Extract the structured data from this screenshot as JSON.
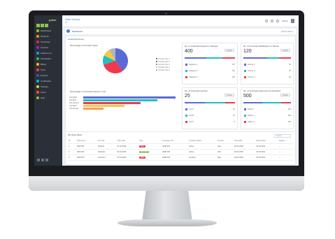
{
  "app": {
    "logo_text": "pulse",
    "school_name": "Sabi School",
    "school_sub": "ID",
    "user_name": "Admin",
    "accent": "#3f7fe0"
  },
  "sidebar": {
    "items": [
      {
        "label": "Dashboard",
        "color": "#8bc34a"
      },
      {
        "label": "Students",
        "color": "#ff9800"
      },
      {
        "label": "Instructors",
        "color": "#e91e63"
      },
      {
        "label": "Courses",
        "color": "#9c27b0"
      },
      {
        "label": "Classrooms",
        "color": "#03a9f4"
      },
      {
        "label": "Scheduling",
        "color": "#4caf50"
      },
      {
        "label": "Billing",
        "color": "#ffc107"
      },
      {
        "label": "Tests",
        "color": "#f44336"
      },
      {
        "label": "Reports",
        "color": "#3f51b5"
      },
      {
        "label": "Certificates",
        "color": "#00bcd4"
      },
      {
        "label": "Settings",
        "color": "#cddc39"
      },
      {
        "label": "Users",
        "color": "#ff5722"
      },
      {
        "label": "Help",
        "color": "#8bc34a"
      }
    ]
  },
  "page_header": {
    "title": "Dashboard",
    "right_label": "Admin Menu"
  },
  "summary": {
    "title": "Overall Summary"
  },
  "pie_card": {
    "title": "Percentage of Contract Types",
    "legend": [
      "Contract Type 1",
      "Contract Type 2",
      "Contract Type 3",
      "Contract Type 4",
      "Contract Type 5"
    ]
  },
  "pie_data": [
    {
      "value": 40,
      "color": "#5b6bd6"
    },
    {
      "value": 30,
      "color": "#f0384f"
    },
    {
      "value": 12,
      "color": "#1ec1c0"
    },
    {
      "value": 10,
      "color": "#f7c842"
    },
    {
      "value": 8,
      "color": "#b0b5bd"
    }
  ],
  "bar_card": {
    "title": "Percentage of contracts based on Unit",
    "bars": [
      {
        "label": "Unit Alpha",
        "value": 100,
        "color": "#5b6bd6"
      },
      {
        "label": "Unit Beta",
        "value": 80,
        "color": "#1ec1c0"
      },
      {
        "label": "Unit Gamma",
        "value": 62,
        "color": "#f0384f"
      },
      {
        "label": "Unit Delta",
        "value": 45,
        "color": "#f7c842"
      },
      {
        "label": "Unit Omega",
        "value": 22,
        "color": "#f39c5a"
      }
    ]
  },
  "stats": [
    {
      "title": "No. of Contracts based on Category",
      "value": "400",
      "button": "Details",
      "rows": [
        {
          "label": "Category 1",
          "value": "170",
          "color": "#5b6bd6"
        },
        {
          "label": "Category 2",
          "value": "130",
          "color": "#1ec1c0"
        },
        {
          "label": "Category 3",
          "value": "100",
          "color": "#f0384f"
        }
      ]
    },
    {
      "title": "No. of Contracts Withdrawn on Source",
      "value": "120",
      "button": "Details",
      "rows": [
        {
          "label": "Source 1",
          "value": "60",
          "color": "#5b6bd6"
        },
        {
          "label": "Source 2",
          "value": "30",
          "color": "#1ec1c0"
        },
        {
          "label": "Source 3",
          "value": "30",
          "color": "#f0384f"
        }
      ]
    },
    {
      "title": "No. of Contracts expired",
      "value": "25",
      "button": "Details",
      "rows": [
        {
          "label": "Unit A",
          "value": "10",
          "color": "#5b6bd6"
        },
        {
          "label": "Unit B",
          "value": "10",
          "color": "#1ec1c0"
        },
        {
          "label": "Unit C",
          "value": "5",
          "color": "#f0384f"
        }
      ]
    },
    {
      "title": "No. of Contracts approved as submitted",
      "value": "500",
      "button": "Details",
      "rows": [
        {
          "label": "Status 1",
          "value": "200",
          "color": "#5b6bd6"
        },
        {
          "label": "Status 2",
          "value": "200",
          "color": "#1ec1c0"
        },
        {
          "label": "Status 3",
          "value": "100",
          "color": "#f0384f"
        }
      ]
    }
  ],
  "table": {
    "label": "My Open Work",
    "search_placeholder": "Search",
    "headers": [
      "ID",
      "Reference",
      "Job Title",
      "Start Date",
      "Type",
      "Employee No.",
      "Contract Status",
      "Contact",
      "Start Date",
      "Expiry Date",
      "Actions"
    ],
    "rows": [
      [
        "1",
        "REF-001",
        "Teacher",
        "01.01.2020",
        "New",
        "EMP 001",
        "Active",
        "Jane",
        "01.02.2020",
        "01.02.2021",
        "⋮"
      ],
      [
        "2",
        "REF-002",
        "Assistant",
        "02.01.2020",
        "Renewal",
        "EMP 002",
        "Active",
        "John",
        "02.02.2020",
        "02.02.2021",
        "⋮"
      ],
      [
        "3",
        "REF-003",
        "Instructor",
        "03.01.2020",
        "New",
        "EMP 003",
        "Pending",
        "Mary",
        "03.02.2020",
        "03.02.2021",
        "⋮"
      ]
    ],
    "tag_colors": [
      "#f0384f",
      "#8bc34a",
      "#f0384f"
    ]
  }
}
